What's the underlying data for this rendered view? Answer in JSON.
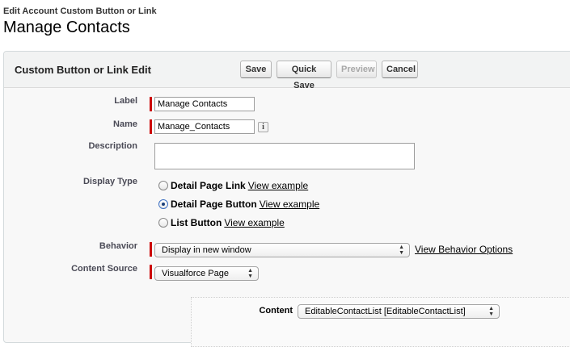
{
  "header": {
    "subtitle": "Edit Account Custom Button or Link",
    "title": "Manage Contacts"
  },
  "panel": {
    "title": "Custom Button or Link Edit",
    "buttons": {
      "save": "Save",
      "quick_save": "Quick Save",
      "preview": "Preview",
      "cancel": "Cancel"
    }
  },
  "form": {
    "label": {
      "label": "Label",
      "value": "Manage Contacts"
    },
    "name": {
      "label": "Name",
      "value": "Manage_Contacts",
      "info_icon": "i"
    },
    "description": {
      "label": "Description",
      "value": ""
    },
    "display_type": {
      "label": "Display Type",
      "options": [
        {
          "label": "Detail Page Link",
          "link": "View example",
          "checked": false
        },
        {
          "label": "Detail Page Button",
          "link": "View example",
          "checked": true
        },
        {
          "label": "List Button",
          "link": "View example",
          "checked": false
        }
      ]
    },
    "behavior": {
      "label": "Behavior",
      "selected": "Display in new window",
      "link": "View Behavior Options"
    },
    "content_source": {
      "label": "Content Source",
      "selected": "Visualforce Page"
    },
    "content": {
      "label": "Content",
      "selected": "EditableContactList [EditableContactList]"
    }
  },
  "colors": {
    "required": "#cc0000",
    "panel_bg": "#f8f8f8",
    "header_bg": "#f2f3f3"
  }
}
